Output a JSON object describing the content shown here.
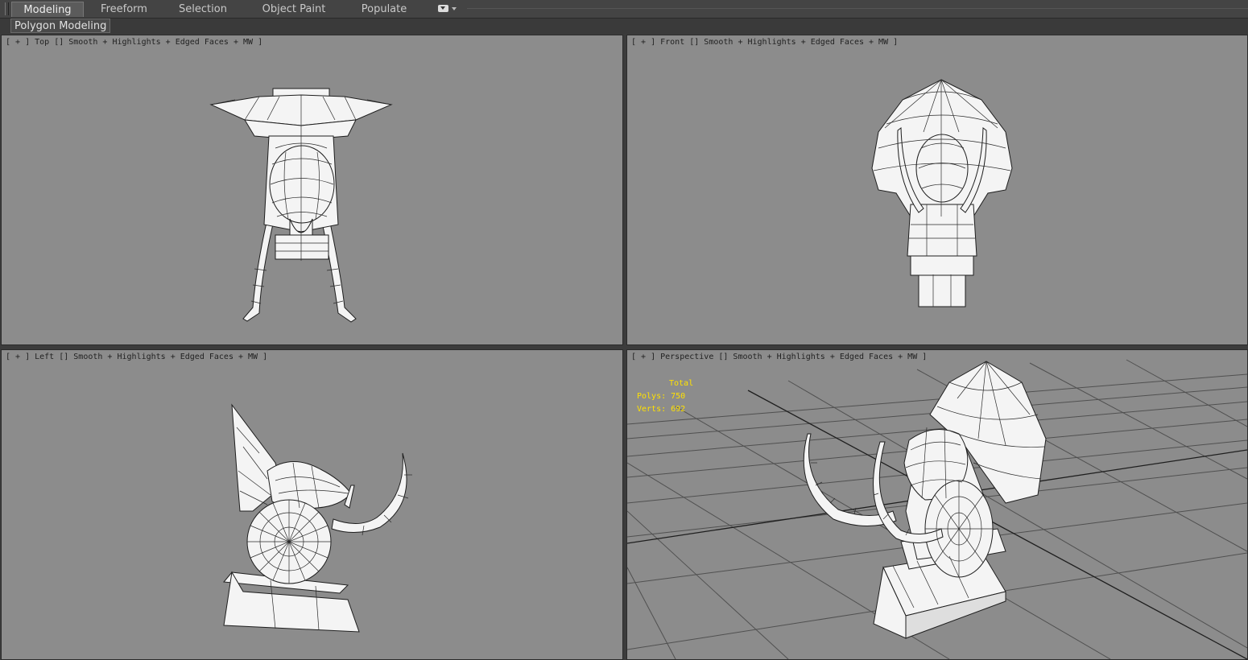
{
  "ribbon": {
    "tabs": [
      {
        "label": "Modeling",
        "active": true
      },
      {
        "label": "Freeform",
        "active": false
      },
      {
        "label": "Selection",
        "active": false
      },
      {
        "label": "Object Paint",
        "active": false
      },
      {
        "label": "Populate",
        "active": false
      }
    ],
    "menu_icon": "dropdown-menu-icon"
  },
  "panel": {
    "label": "Polygon Modeling"
  },
  "viewports": {
    "top": {
      "label": "[ + ] Top [] Smooth + Highlights + Edged Faces + MW ]"
    },
    "front": {
      "label": "[ + ] Front [] Smooth + Highlights + Edged Faces + MW ]"
    },
    "left": {
      "label": "[ + ] Left [] Smooth + Highlights + Edged Faces + MW ]"
    },
    "persp": {
      "label": "[ + ] Perspective [] Smooth + Highlights + Edged Faces + MW ]"
    }
  },
  "stats": {
    "header": "Total",
    "polys": "Polys: 750",
    "verts": "Verts: 692"
  },
  "colors": {
    "viewport_bg": "#8c8c8c",
    "stats_text": "#ffe100",
    "ui_bg": "#3c3c3c",
    "model_fill": "#f4f4f4"
  }
}
